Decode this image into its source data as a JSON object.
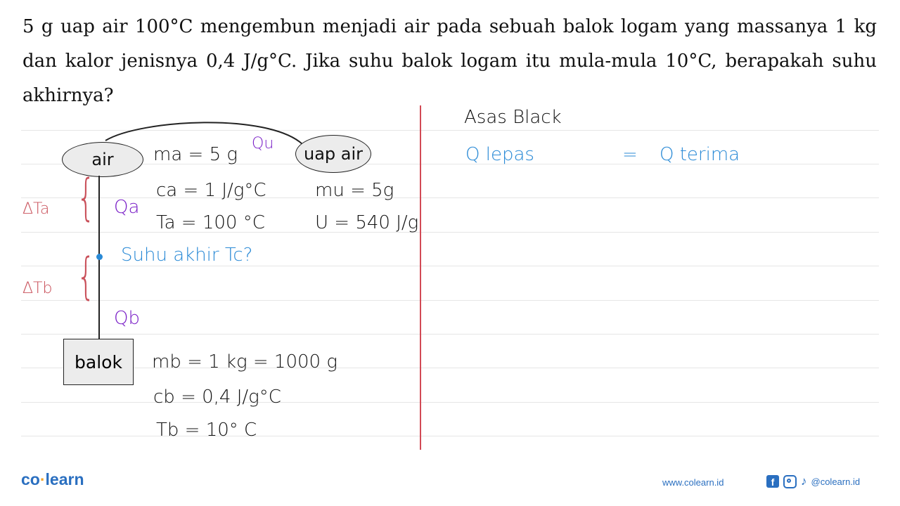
{
  "question": "5 g uap air 100°C mengembun menjadi air pada sebuah balok logam yang massanya 1 kg dan kalor jenisnya 0,4 J/g°C. Jika suhu balok logam itu mula-mula 10°C, berapakah suhu akhirnya?",
  "diagram": {
    "air_label": "air",
    "uap_air_label": "uap air",
    "balok_label": "balok",
    "qu": "Qu",
    "qa": "Qa",
    "qb": "Qb",
    "delta_ta": "ΔTa",
    "delta_tb": "ΔTb",
    "suhu_akhir": "Suhu akhir Tc?"
  },
  "givens": {
    "ma": "ma = 5 g",
    "ca": "ca = 1 J/g°C",
    "ta": "Ta = 100 °C",
    "mu": "mu = 5g",
    "u": "U = 540 J/g",
    "mb": "mb = 1 kg = 1000 g",
    "cb": "cb = 0,4 J/g°C",
    "tb": "Tb = 10° C"
  },
  "solution": {
    "title": "Asas Black",
    "equation_left": "Q lepas",
    "equals": "=",
    "equation_right": "Q terima"
  },
  "footer": {
    "logo_co": "co",
    "logo_sep": "·",
    "logo_learn": "learn",
    "website": "www.colearn.id",
    "social_handle": "@colearn.id",
    "icons": [
      "facebook-icon",
      "instagram-icon",
      "tiktok-icon"
    ]
  },
  "colors": {
    "purple": "#7a1fc7",
    "red": "#c9505a",
    "blue": "#2a8ad6",
    "brand": "#2a6fc0"
  }
}
